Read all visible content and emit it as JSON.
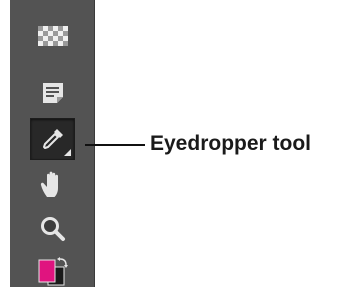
{
  "toolbar": {
    "tools": [
      {
        "name": "transparency-grid",
        "icon": "checkerboard-icon",
        "active": false
      },
      {
        "name": "note",
        "icon": "note-icon",
        "active": false
      },
      {
        "name": "eyedropper",
        "icon": "eyedropper-icon",
        "active": true
      },
      {
        "name": "hand",
        "icon": "hand-icon",
        "active": false
      },
      {
        "name": "zoom",
        "icon": "magnifier-icon",
        "active": false
      },
      {
        "name": "color-swatches",
        "icon": "color-swatch-icon",
        "active": false
      }
    ],
    "foreground_color": "#e0147f",
    "background_color": "#1a1a1a"
  },
  "callout": {
    "label": "Eyedropper tool"
  },
  "colors": {
    "toolbar_bg": "#535353",
    "active_tool_bg": "#282828",
    "icon": "#e6e6e6"
  }
}
